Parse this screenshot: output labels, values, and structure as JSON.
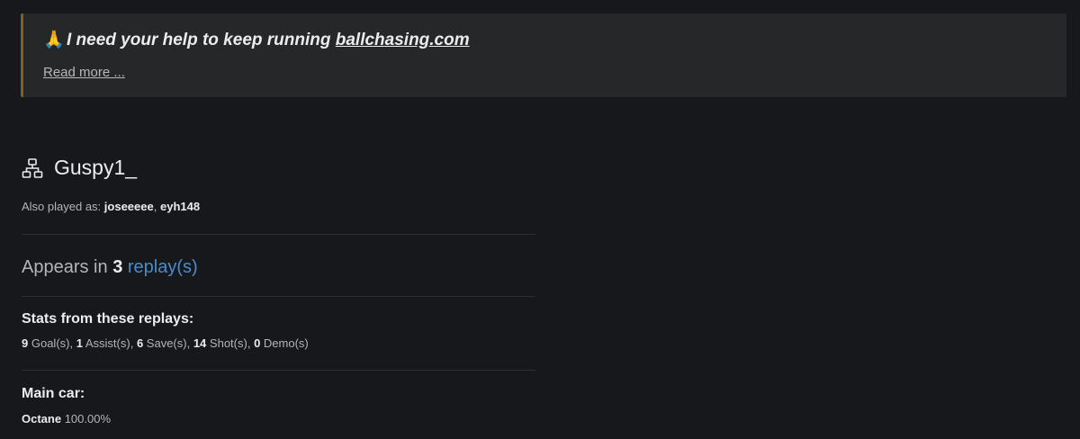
{
  "banner": {
    "emoji": "🙏",
    "title_text": "I need your help to keep running ",
    "title_link": "ballchasing.com",
    "read_more": "Read more ..."
  },
  "player": {
    "name": "Guspy1_",
    "icon": "network-icon",
    "also_played_label": "Also played as:",
    "aliases": [
      "joseeeee",
      "eyh148"
    ],
    "alias_separator": ","
  },
  "appears": {
    "prefix": "Appears in",
    "count": "3",
    "link": "replay(s)"
  },
  "stats": {
    "heading": "Stats from these replays:",
    "items": [
      {
        "value": "9",
        "label": "Goal(s),"
      },
      {
        "value": "1",
        "label": "Assist(s),"
      },
      {
        "value": "6",
        "label": "Save(s),"
      },
      {
        "value": "14",
        "label": "Shot(s),"
      },
      {
        "value": "0",
        "label": "Demo(s)"
      }
    ]
  },
  "main_car": {
    "heading": "Main car:",
    "name": "Octane",
    "percent": "100.00%"
  },
  "colors": {
    "background": "#17181c",
    "banner_bg": "#262729",
    "banner_accent": "#7d6323",
    "link": "#4a8cc8"
  }
}
